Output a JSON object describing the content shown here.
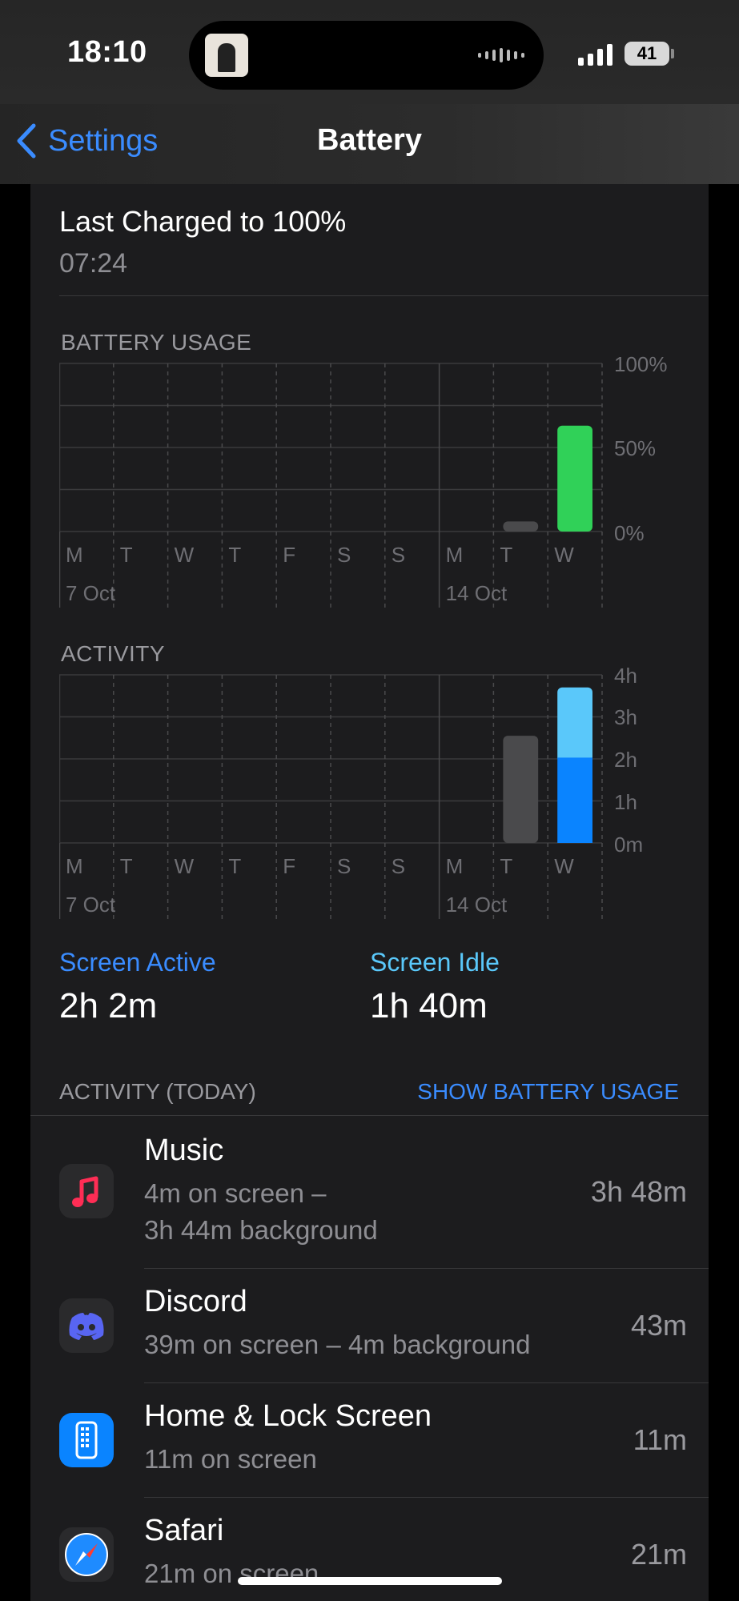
{
  "status_bar": {
    "time": "18:10",
    "battery_level": "41"
  },
  "nav": {
    "back_label": "Settings",
    "title": "Battery"
  },
  "last_charged": {
    "title": "Last Charged to 100%",
    "time": "07:24"
  },
  "battery_usage": {
    "label": "BATTERY USAGE",
    "y_ticks": [
      "100%",
      "50%",
      "0%"
    ],
    "days": [
      "M",
      "T",
      "W",
      "T",
      "F",
      "S",
      "S",
      "M",
      "T",
      "W"
    ],
    "dates": [
      "7 Oct",
      "14 Oct"
    ],
    "chart_data": {
      "type": "bar",
      "title": "BATTERY USAGE",
      "categories": [
        "M",
        "T",
        "W",
        "T",
        "F",
        "S",
        "S",
        "M",
        "T",
        "W"
      ],
      "values": [
        null,
        null,
        null,
        null,
        null,
        null,
        null,
        null,
        6,
        63
      ],
      "ylim": [
        0,
        100
      ],
      "colors": [
        "#4a4a4c",
        "#4a4a4c",
        "#4a4a4c",
        "#4a4a4c",
        "#4a4a4c",
        "#4a4a4c",
        "#4a4a4c",
        "#4a4a4c",
        "#4a4a4c",
        "#30d158"
      ]
    }
  },
  "activity": {
    "label": "ACTIVITY",
    "y_ticks": [
      "4h",
      "3h",
      "2h",
      "1h",
      "0m"
    ],
    "days": [
      "M",
      "T",
      "W",
      "T",
      "F",
      "S",
      "S",
      "M",
      "T",
      "W"
    ],
    "dates": [
      "7 Oct",
      "14 Oct"
    ],
    "chart_data": {
      "type": "bar",
      "title": "ACTIVITY",
      "categories": [
        "M",
        "T",
        "W",
        "T",
        "F",
        "S",
        "S",
        "M",
        "T",
        "W"
      ],
      "series": [
        {
          "values": [
            null,
            null,
            null,
            null,
            null,
            null,
            null,
            null,
            2.55,
            2.03
          ]
        },
        {
          "values": [
            null,
            null,
            null,
            null,
            null,
            null,
            null,
            null,
            0,
            1.67
          ]
        }
      ],
      "ylim": [
        0,
        4
      ],
      "colors": {
        "past": "#4a4a4c",
        "active": "#0a84ff",
        "idle": "#5ac8fa"
      }
    }
  },
  "stats": {
    "active_label": "Screen Active",
    "active_value": "2h 2m",
    "idle_label": "Screen Idle",
    "idle_value": "1h 40m"
  },
  "activity_today": {
    "label": "ACTIVITY (TODAY)",
    "toggle": "SHOW BATTERY USAGE",
    "apps": [
      {
        "name": "Music",
        "sub1": "4m on screen –",
        "sub2": "3h 44m background",
        "time": "3h 48m",
        "icon": "music-icon"
      },
      {
        "name": "Discord",
        "sub1": "39m on screen – 4m background",
        "sub2": "",
        "time": "43m",
        "icon": "discord-icon"
      },
      {
        "name": "Home & Lock Screen",
        "sub1": "11m on screen",
        "sub2": "",
        "time": "11m",
        "icon": "home-lock-icon"
      },
      {
        "name": "Safari",
        "sub1": "21m on screen",
        "sub2": "",
        "time": "21m",
        "icon": "safari-icon"
      }
    ]
  }
}
